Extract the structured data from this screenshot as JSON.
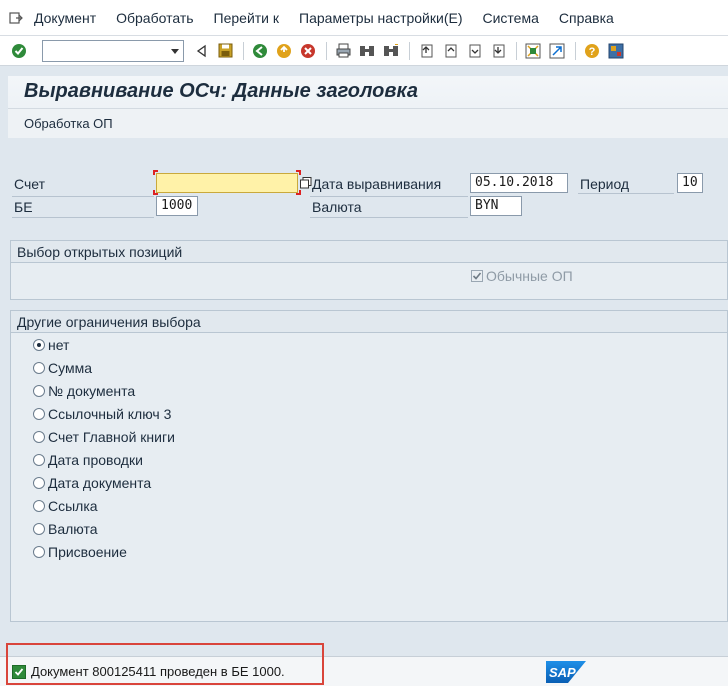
{
  "menu": {
    "items": [
      "Документ",
      "Обработать",
      "Перейти к",
      "Параметры настройки(Е)",
      "Система",
      "Справка"
    ]
  },
  "toolbar": {
    "command_value": ""
  },
  "title": {
    "main": "Выравнивание ОСч: Данные заголовка",
    "sub": "Обработка ОП"
  },
  "header": {
    "account_label": "Счет",
    "account_value": "",
    "company_label": "БЕ",
    "company_value": "1000",
    "date_label": "Дата выравнивания",
    "date_value": "05.10.2018",
    "period_label": "Период",
    "period_value": "10",
    "currency_label": "Валюта",
    "currency_value": "BYN"
  },
  "open_items_group": {
    "title": "Выбор открытых позиций",
    "checkbox_label": "Обычные ОП",
    "checkbox_checked": true
  },
  "other_selection": {
    "title": "Другие ограничения выбора",
    "options": [
      "нет",
      "Сумма",
      "№ документа",
      "Ссылочный ключ 3",
      "Счет Главной книги",
      "Дата проводки",
      "Дата документа",
      "Ссылка",
      "Валюта",
      "Присвоение"
    ],
    "selected_index": 0
  },
  "status": {
    "message": "Документ 800125411 проведен в БЕ 1000.",
    "type": "success"
  },
  "logo": {
    "text": "SAP"
  },
  "colors": {
    "required_field": "#fff2a8",
    "status_highlight": "#d9453b",
    "sap_blue": "#0a6ed1"
  }
}
